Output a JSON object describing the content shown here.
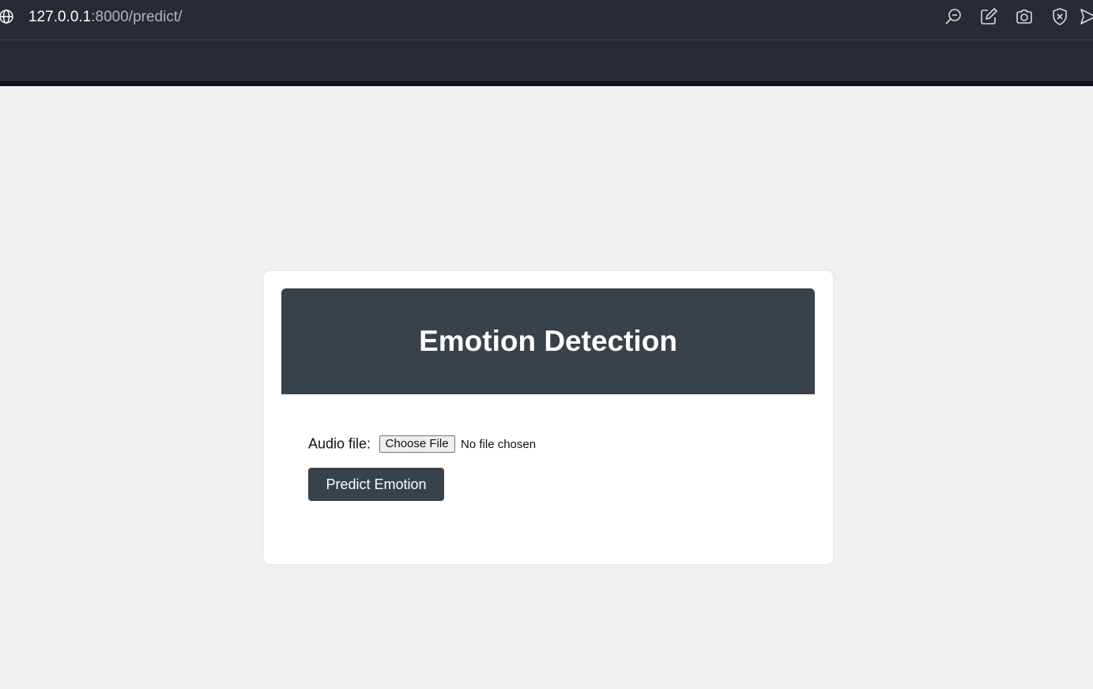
{
  "browser": {
    "url_host": "127.0.0.1",
    "url_rest": ":8000/predict/",
    "icons": [
      "globe-icon",
      "zoom-icon",
      "edit-icon",
      "camera-icon",
      "shield-icon",
      "send-icon"
    ]
  },
  "page": {
    "title": "Emotion Detection",
    "form": {
      "audio_label": "Audio file:",
      "choose_file_label": "Choose File",
      "no_file_text": "No file chosen",
      "submit_label": "Predict Emotion"
    }
  },
  "colors": {
    "browser_bar": "#272b36",
    "page_bg": "#f0f0f0",
    "header_bg": "#37424b",
    "button_bg": "#37424b"
  }
}
